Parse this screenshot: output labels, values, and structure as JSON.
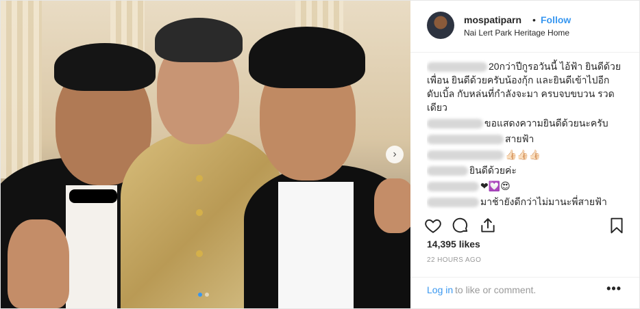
{
  "post": {
    "username": "mospatiparn",
    "separator": "•",
    "follow_label": "Follow",
    "location": "Nai Lert Park Heritage Home",
    "caption_text": "20กว่าปีกูรอวันนี้ ไอ้ฟ้า ยินดีด้วยเพื่อน ยินดีด้วยครับน้องกุ้ก และยินดีเข้าไปอีกดับเบิ้ล กับหล่นที่กำลังจะมา ครบจบขบวน รวดเดียว",
    "comments": [
      {
        "text": "ขอแสดงความยินดีด้วยนะครับ"
      },
      {
        "text": "สายฟ้า"
      },
      {
        "text": "👍🏻👍🏻👍🏻"
      },
      {
        "text": "ยินดีด้วยค่ะ"
      },
      {
        "text": "❤💟😍"
      },
      {
        "text": "มาช้ายังดีกว่าไม่มานะพี่สายฟ้า"
      }
    ],
    "likes": "14,395 likes",
    "timestamp": "22 HOURS AGO",
    "login_link": "Log in",
    "login_rest": "to like or comment.",
    "more_label": "•••",
    "carousel_arrow": "›"
  },
  "icons": [
    "heart-icon",
    "comment-icon",
    "share-icon",
    "bookmark-icon",
    "chevron-right-icon"
  ],
  "colors": {
    "accent": "#3897f0",
    "text": "#262626",
    "muted": "#999999",
    "border": "#efefef"
  }
}
